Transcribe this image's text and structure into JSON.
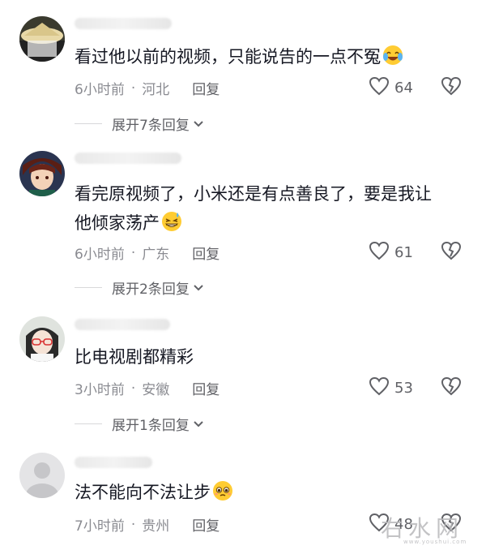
{
  "comments": [
    {
      "text": "看过他以前的视频，只能说告的一点不冤",
      "emoji": "laughing-tears-emoji",
      "time": "6小时前",
      "location": "河北",
      "reply_label": "回复",
      "likes": "64",
      "expand": "展开7条回复"
    },
    {
      "text_line1": "看完原视频了，小米还是有点善良了，要是我让",
      "text_line2": "他倾家荡产",
      "emoji": "sweat-grin-emoji",
      "time": "6小时前",
      "location": "广东",
      "reply_label": "回复",
      "likes": "61",
      "expand": "展开2条回复"
    },
    {
      "text": "比电视剧都精彩",
      "time": "3小时前",
      "location": "安徽",
      "reply_label": "回复",
      "likes": "53",
      "expand": "展开1条回复"
    },
    {
      "text": "法不能向不法让步",
      "emoji": "pleading-face-emoji",
      "time": "7小时前",
      "location": "贵州",
      "reply_label": "回复",
      "likes": "48"
    }
  ],
  "watermark": {
    "text": "右水网",
    "sub": "www.youshui.com"
  },
  "colors": {
    "text": "#161823",
    "meta": "#8a8b91",
    "action": "#606166"
  }
}
